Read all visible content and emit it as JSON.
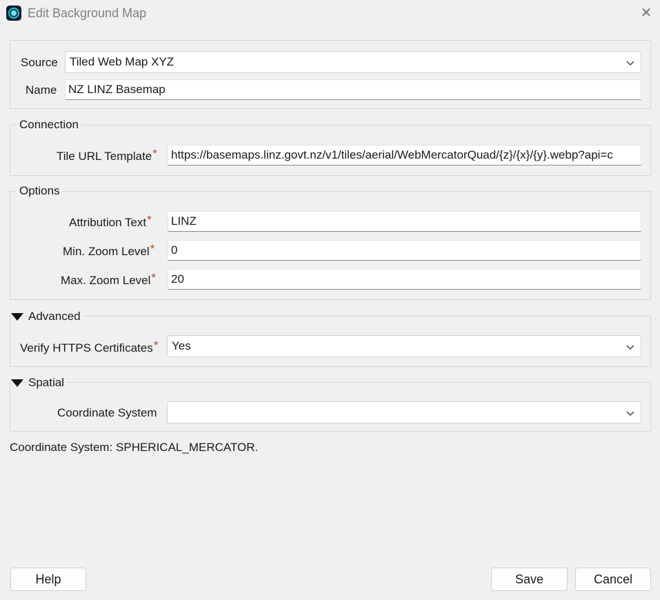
{
  "window": {
    "title": "Edit Background Map",
    "app_icon": "app-logo-icon",
    "close_glyph": "✕"
  },
  "source": {
    "label": "Source",
    "value": "Tiled Web Map XYZ"
  },
  "name": {
    "label": "Name",
    "value": "NZ LINZ Basemap"
  },
  "connection": {
    "legend": "Connection",
    "tile_url_label": "Tile URL Template",
    "tile_url_value": "https://basemaps.linz.govt.nz/v1/tiles/aerial/WebMercatorQuad/{z}/{x}/{y}.webp?api=c"
  },
  "options": {
    "legend": "Options",
    "attribution_label": "Attribution Text",
    "attribution_value": "LINZ",
    "min_zoom_label": "Min. Zoom Level",
    "min_zoom_value": "0",
    "max_zoom_label": "Max. Zoom Level",
    "max_zoom_value": "20"
  },
  "advanced": {
    "legend": "Advanced",
    "verify_label": "Verify HTTPS Certificates",
    "verify_value": "Yes"
  },
  "spatial": {
    "legend": "Spatial",
    "coord_label": "Coordinate System",
    "coord_value": ""
  },
  "required_marker": "*",
  "status_text": "Coordinate System: SPHERICAL_MERCATOR.",
  "buttons": {
    "help": "Help",
    "save": "Save",
    "cancel": "Cancel"
  },
  "colors": {
    "required": "#c0392b",
    "accent": "#24c3e0"
  }
}
